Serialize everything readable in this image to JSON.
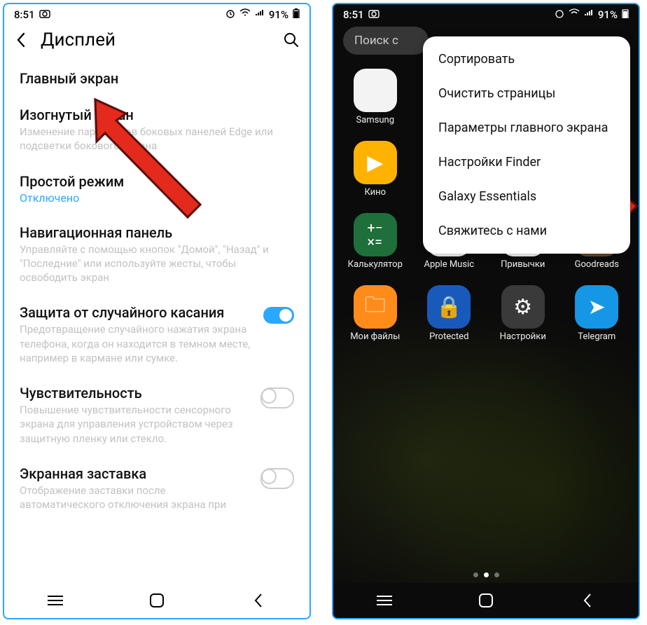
{
  "left": {
    "status": {
      "time": "8:51",
      "battery": "91%"
    },
    "header": {
      "title": "Дисплей"
    },
    "items": [
      {
        "title": "Главный экран"
      },
      {
        "title": "Изогнутый экран",
        "desc": "Изменение параметров боковых панелей Edge или подсветки бокового экрана"
      },
      {
        "title": "Простой режим",
        "status": "Отключено"
      },
      {
        "title": "Навигационная панель",
        "desc": "Управляйте с помощью кнопок \"Домой\", \"Назад\" и \"Последние\" или используйте жесты, чтобы освободить экран"
      },
      {
        "title": "Защита от случайного касания",
        "desc": "Предотвращение случайного нажатия экрана телефона, когда он находится в темном месте, например в кармане или сумке.",
        "toggle": "on"
      },
      {
        "title": "Чувствительность",
        "desc": "Повышение чувствительности сенсорного экрана для управления устройством через защитную пленку или стекло.",
        "toggle": "off"
      },
      {
        "title": "Экранная заставка",
        "desc": "Отображение заставки после автоматического отключения экрана при",
        "toggle": "off"
      }
    ]
  },
  "right": {
    "status": {
      "time": "8:51",
      "battery": "91%"
    },
    "search_placeholder": "Поиск с",
    "menu": [
      "Сортировать",
      "Очистить страницы",
      "Параметры главного экрана",
      "Настройки Finder",
      "Galaxy Essentials",
      "Свяжитесь с нами"
    ],
    "apps": [
      {
        "label": "Samsung",
        "color": "#f3f3f3"
      },
      {
        "label": "Кино",
        "color": "#ffb300"
      },
      {
        "label": "Калькулятор",
        "color": "#1e6f3a"
      },
      {
        "label": "Apple Music",
        "color": "#ffffff"
      },
      {
        "label": "Привычки",
        "color": "#ffffff"
      },
      {
        "label": "Goodreads",
        "color": "#6b4a2c"
      },
      {
        "label": "Мои файлы",
        "color": "#ff8c1a"
      },
      {
        "label": "Protected",
        "color": "#185abc"
      },
      {
        "label": "Настройки",
        "color": "#3a3a3a"
      },
      {
        "label": "Telegram",
        "color": "#1597e5"
      }
    ]
  }
}
